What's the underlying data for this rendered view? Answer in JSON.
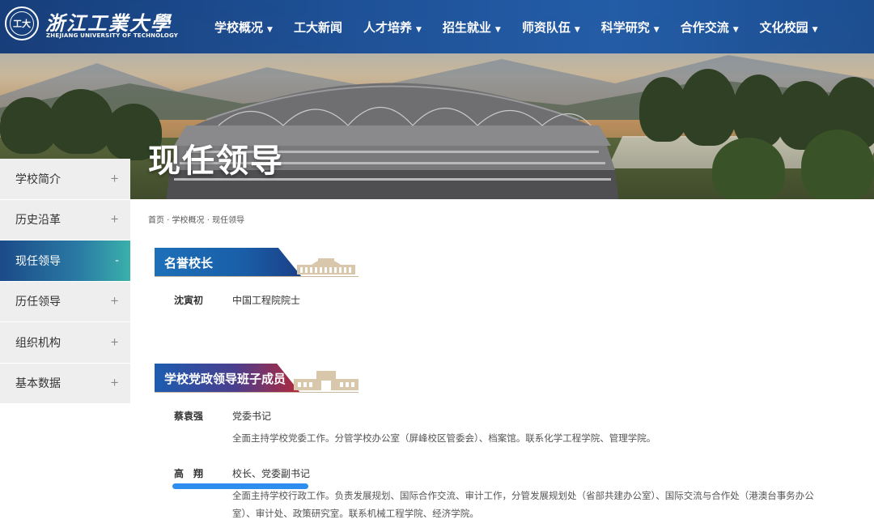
{
  "header": {
    "logo_cn": "浙江工業大學",
    "logo_en": "ZHEJIANG UNIVERSITY OF TECHNOLOGY",
    "logo_seal_text": "工大",
    "nav": [
      {
        "label": "学校概况",
        "caret": "▼"
      },
      {
        "label": "工大新闻",
        "caret": ""
      },
      {
        "label": "人才培养",
        "caret": "▼"
      },
      {
        "label": "招生就业",
        "caret": "▼"
      },
      {
        "label": "师资队伍",
        "caret": "▼"
      },
      {
        "label": "科学研究",
        "caret": "▼"
      },
      {
        "label": "合作交流",
        "caret": "▼"
      },
      {
        "label": "文化校园",
        "caret": "▼"
      }
    ]
  },
  "hero": {
    "title": "现任领导"
  },
  "sidebar": {
    "items": [
      {
        "label": "学校简介",
        "sign": "+"
      },
      {
        "label": "历史沿革",
        "sign": "+"
      },
      {
        "label": "现任领导",
        "sign": "-",
        "active": true
      },
      {
        "label": "历任领导",
        "sign": "+"
      },
      {
        "label": "组织机构",
        "sign": "+"
      },
      {
        "label": "基本数据",
        "sign": "+"
      }
    ]
  },
  "breadcrumb": "首页 · 学校概况 · 现任领导",
  "sections": [
    {
      "title": "名誉校长",
      "people": [
        {
          "name": "沈寅初",
          "title": "中国工程院院士",
          "duty": ""
        }
      ]
    },
    {
      "title": "学校党政领导班子成员",
      "people": [
        {
          "name": "蔡袁强",
          "title": "党委书记",
          "duty": "全面主持学校党委工作。分管学校办公室（屏峰校区管委会）、档案馆。联系化学工程学院、管理学院。"
        },
        {
          "name": "高　翔",
          "title": "校长、党委副书记",
          "duty": "全面主持学校行政工作。负责发展规划、国际合作交流、审计工作，分管发展规划处（省部共建办公室）、国际交流与合作处（港澳台事务办公室）、审计处、政策研究室。联系机械工程学院、经济学院。"
        }
      ]
    }
  ],
  "colors": {
    "nav_bg": "#1a4e96",
    "sidebar_active": "#2a7aa4",
    "sidebar_bg": "#eeeeee",
    "highlight": "#2e8ef0"
  }
}
